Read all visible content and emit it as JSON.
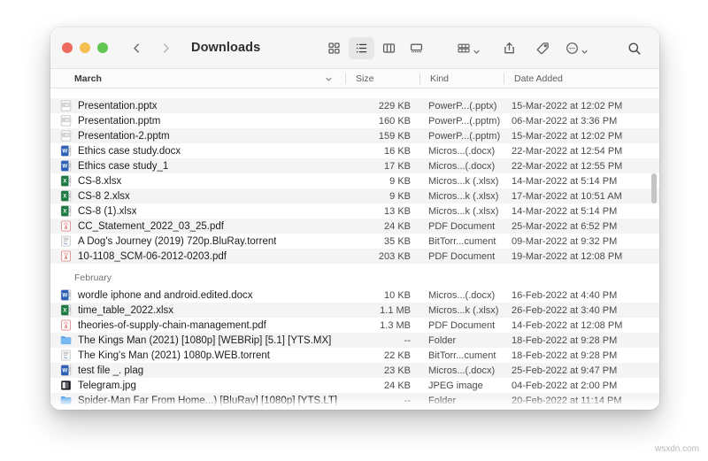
{
  "window": {
    "title": "Downloads",
    "traffic_lights": [
      {
        "name": "close",
        "color": "#ed6a5e"
      },
      {
        "name": "minimize",
        "color": "#f5bf4f"
      },
      {
        "name": "zoom",
        "color": "#62c554"
      }
    ],
    "nav": {
      "back": "back-icon",
      "forward": "forward-icon"
    }
  },
  "toolbar": {
    "view_icon_grid": "grid-view-icon",
    "view_icon_list": "list-view-icon",
    "view_icon_column": "column-view-icon",
    "view_icon_gallery": "gallery-view-icon",
    "active_view": "list",
    "group_icon": "group-by-icon",
    "share_icon": "share-icon",
    "tag_icon": "tag-icon",
    "more_icon": "more-options-icon",
    "search_icon": "search-icon"
  },
  "columns": {
    "name": "March",
    "size": "Size",
    "kind": "Kind",
    "date": "Date Added",
    "sort_caret": "chevron-down-icon"
  },
  "groups": [
    {
      "label": "",
      "files": [
        {
          "name": "Presentation.pptx",
          "size": "229 KB",
          "kind": "PowerP...(.pptx)",
          "date": "15-Mar-2022 at 12:02 PM",
          "icon": "powerpoint"
        },
        {
          "name": "Presentation.pptm",
          "size": "160 KB",
          "kind": "PowerP...(.pptm)",
          "date": "06-Mar-2022 at 3:36 PM",
          "icon": "powerpoint"
        },
        {
          "name": "Presentation-2.pptm",
          "size": "159 KB",
          "kind": "PowerP...(.pptm)",
          "date": "15-Mar-2022 at 12:02 PM",
          "icon": "powerpoint"
        },
        {
          "name": "Ethics case study.docx",
          "size": "16 KB",
          "kind": "Micros...(.docx)",
          "date": "22-Mar-2022 at 12:54 PM",
          "icon": "word"
        },
        {
          "name": "Ethics case study_1",
          "size": "17 KB",
          "kind": "Micros...(.docx)",
          "date": "22-Mar-2022 at 12:55 PM",
          "icon": "word"
        },
        {
          "name": "CS-8.xlsx",
          "size": "9 KB",
          "kind": "Micros...k (.xlsx)",
          "date": "14-Mar-2022 at 5:14 PM",
          "icon": "excel"
        },
        {
          "name": "CS-8 2.xlsx",
          "size": "9 KB",
          "kind": "Micros...k (.xlsx)",
          "date": "17-Mar-2022 at 10:51 AM",
          "icon": "excel"
        },
        {
          "name": "CS-8 (1).xlsx",
          "size": "13 KB",
          "kind": "Micros...k (.xlsx)",
          "date": "14-Mar-2022 at 5:14 PM",
          "icon": "excel"
        },
        {
          "name": "CC_Statement_2022_03_25.pdf",
          "size": "24 KB",
          "kind": "PDF Document",
          "date": "25-Mar-2022 at 6:52 PM",
          "icon": "pdf"
        },
        {
          "name": "A Dog's Journey (2019) 720p.BluRay.torrent",
          "size": "35 KB",
          "kind": "BitTorr...cument",
          "date": "09-Mar-2022 at 9:32 PM",
          "icon": "torrent"
        },
        {
          "name": "10-1108_SCM-06-2012-0203.pdf",
          "size": "203 KB",
          "kind": "PDF Document",
          "date": "19-Mar-2022 at 12:08 PM",
          "icon": "pdf"
        }
      ]
    },
    {
      "label": "February",
      "files": [
        {
          "name": "wordle iphone and android.edited.docx",
          "size": "10 KB",
          "kind": "Micros...(.docx)",
          "date": "16-Feb-2022 at 4:40 PM",
          "icon": "word"
        },
        {
          "name": "time_table_2022.xlsx",
          "size": "1.1 MB",
          "kind": "Micros...k (.xlsx)",
          "date": "26-Feb-2022 at 3:40 PM",
          "icon": "excel"
        },
        {
          "name": "theories-of-supply-chain-management.pdf",
          "size": "1.3 MB",
          "kind": "PDF Document",
          "date": "14-Feb-2022 at 12:08 PM",
          "icon": "pdf"
        },
        {
          "name": "The Kings Man (2021) [1080p] [WEBRip] [5.1] [YTS.MX]",
          "size": "--",
          "kind": "Folder",
          "date": "18-Feb-2022 at 9:28 PM",
          "icon": "folder"
        },
        {
          "name": "The King's Man (2021) 1080p.WEB.torrent",
          "size": "22 KB",
          "kind": "BitTorr...cument",
          "date": "18-Feb-2022 at 9:28 PM",
          "icon": "torrent"
        },
        {
          "name": "test file _. plag",
          "size": "23 KB",
          "kind": "Micros...(.docx)",
          "date": "25-Feb-2022 at 9:47 PM",
          "icon": "word"
        },
        {
          "name": "Telegram.jpg",
          "size": "24 KB",
          "kind": "JPEG image",
          "date": "04-Feb-2022 at 2:00 PM",
          "icon": "jpeg"
        },
        {
          "name": "Spider-Man Far From Home...) [BluRay] [1080p] [YTS.LT]",
          "size": "--",
          "kind": "Folder",
          "date": "20-Feb-2022 at 11:14 PM",
          "icon": "folder"
        }
      ]
    }
  ],
  "watermark": "wsxdn.com"
}
